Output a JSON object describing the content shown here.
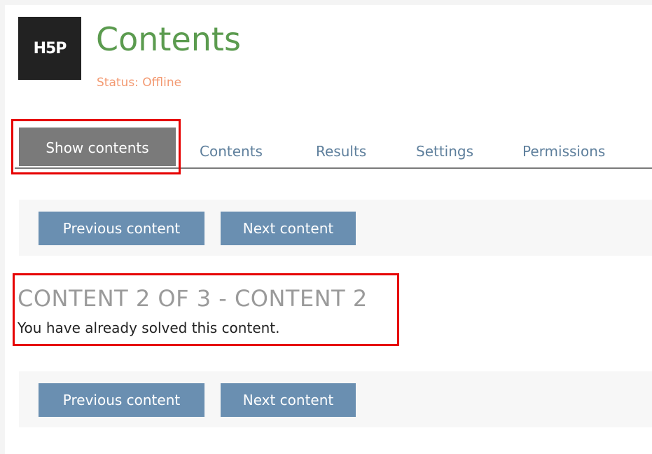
{
  "header": {
    "logo_text": "H5P",
    "title": "Contents",
    "status": "Status: Offline"
  },
  "tabs": [
    {
      "label": "Show contents",
      "active": true
    },
    {
      "label": "Contents"
    },
    {
      "label": "Results"
    },
    {
      "label": "Settings"
    },
    {
      "label": "Permissions"
    }
  ],
  "nav_top": {
    "prev_label": "Previous content",
    "next_label": "Next content"
  },
  "content": {
    "heading": "CONTENT 2 OF 3 - CONTENT 2",
    "message": "You have already solved this content."
  },
  "nav_bottom": {
    "prev_label": "Previous content",
    "next_label": "Next content"
  },
  "colors": {
    "title": "#5b9b4f",
    "status": "#f39a72",
    "button": "#6a8fb1",
    "active_tab": "#7a7a7a",
    "highlight": "#e60000"
  }
}
